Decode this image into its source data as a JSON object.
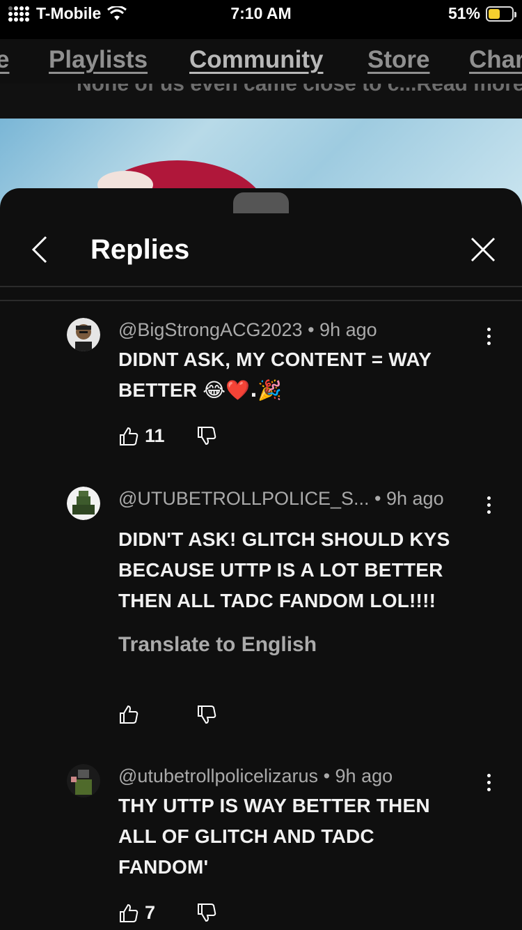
{
  "status_bar": {
    "carrier": "T-Mobile",
    "time": "7:10 AM",
    "battery": "51%",
    "battery_level": 0.51
  },
  "channel_tabs": [
    {
      "label": "e"
    },
    {
      "label": "Playlists"
    },
    {
      "label": "Community",
      "active": true
    },
    {
      "label": "Store"
    },
    {
      "label": "Char"
    }
  ],
  "behind_text": "None of us even came close to c...Read more",
  "sheet": {
    "title": "Replies"
  },
  "comments": [
    {
      "handle": "@BigStrongACG2023",
      "time": "9h ago",
      "text_line1": "DIDNT ASK, MY CONTENT = WAY",
      "text_line2": "BETTER",
      "emojis": "😂❤️.🎉",
      "likes": "11"
    },
    {
      "handle": "@UTUBETROLLPOLICE_S...",
      "time": "9h ago",
      "text_line1": "DIDN'T ASK! GLITCH SHOULD KYS",
      "text_line2": "BECAUSE UTTP IS A LOT BETTER",
      "text_line3": "THEN ALL TADC FANDOM LOL!!!!",
      "translate": "Translate to English",
      "likes": ""
    },
    {
      "handle": "@utubetrollpolicelizarus",
      "time": "9h ago",
      "text_line1": "THY UTTP IS WAY BETTER THEN",
      "text_line2": "ALL OF GLITCH AND TADC",
      "text_line3": "FANDOM'",
      "likes": "7"
    }
  ],
  "colors": {
    "sheet_bg": "#0f0f0f",
    "secondary_text": "#aaaaaa",
    "battery_fill": "#f5d02e"
  }
}
